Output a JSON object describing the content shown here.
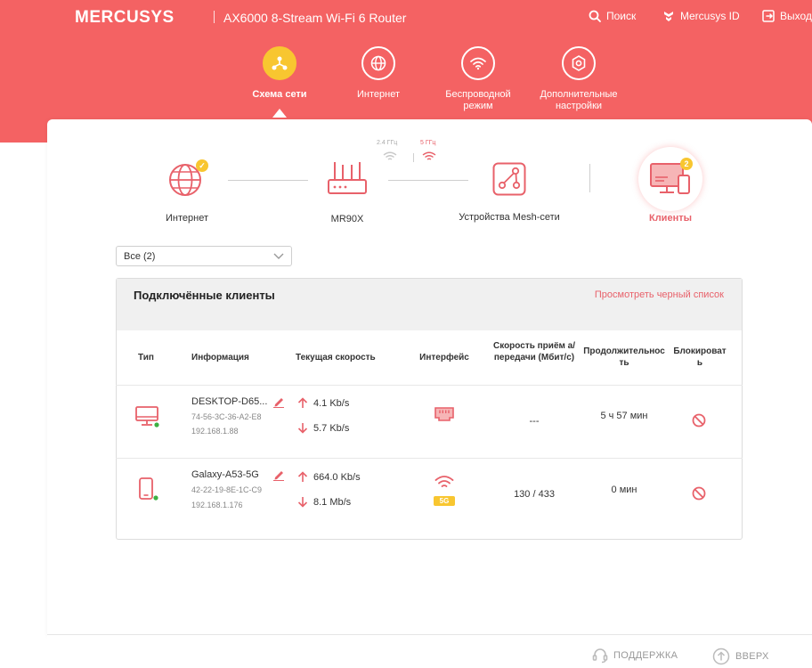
{
  "header": {
    "brand": "MERCUSYS",
    "model": "AX6000 8-Stream Wi-Fi 6 Router",
    "search": "Поиск",
    "mercusys_id": "Mercusys ID",
    "logout": "Выход"
  },
  "nav": {
    "items": [
      {
        "label": "Схема сети",
        "icon": "topology-icon",
        "active": true
      },
      {
        "label": "Интернет",
        "icon": "globe-icon"
      },
      {
        "label": "Беспроводной режим",
        "icon": "wifi-icon"
      },
      {
        "label": "Дополнительные настройки",
        "icon": "settings-icon"
      }
    ]
  },
  "topology": {
    "internet": "Интернет",
    "router": "MR90X",
    "band_24": "2.4 ГГц",
    "band_5": "5 ГГц",
    "mesh": "Устройства Mesh-сети",
    "clients": "Клиенты",
    "clients_count": "2"
  },
  "filter": {
    "value": "Все (2)"
  },
  "clients_table": {
    "title": "Подключённые клиенты",
    "blacklist_link": "Просмотреть черный список",
    "headers": {
      "type": "Тип",
      "info": "Информация",
      "speed": "Текущая скорость",
      "iface": "Интерфейс",
      "rate": "Скорость приём а/передачи (Мбит/с)",
      "duration": "Продолжительность",
      "block": "Блокировать"
    },
    "rows": [
      {
        "name": "DESKTOP-D65...",
        "mac": "74-56-3C-36-A2-E8",
        "ip": "192.168.1.88",
        "up": "4.1 Kb/s",
        "down": "5.7 Kb/s",
        "interface": "ethernet",
        "rate": "---",
        "duration": "5 ч 57 мин"
      },
      {
        "name": "Galaxy-A53-5G",
        "mac": "42-22-19-8E-1C-C9",
        "ip": "192.168.1.176",
        "up": "664.0 Kb/s",
        "down": "8.1 Mb/s",
        "interface": "wifi",
        "band": "5G",
        "rate": "130 / 433",
        "duration": "0 мин"
      }
    ]
  },
  "footer": {
    "support": "ПОДДЕРЖКА",
    "top": "ВВЕРХ"
  },
  "colors": {
    "brand": "#f46263",
    "accent": "#f8c630",
    "icon": "#e8616a",
    "online": "#3cb043"
  }
}
